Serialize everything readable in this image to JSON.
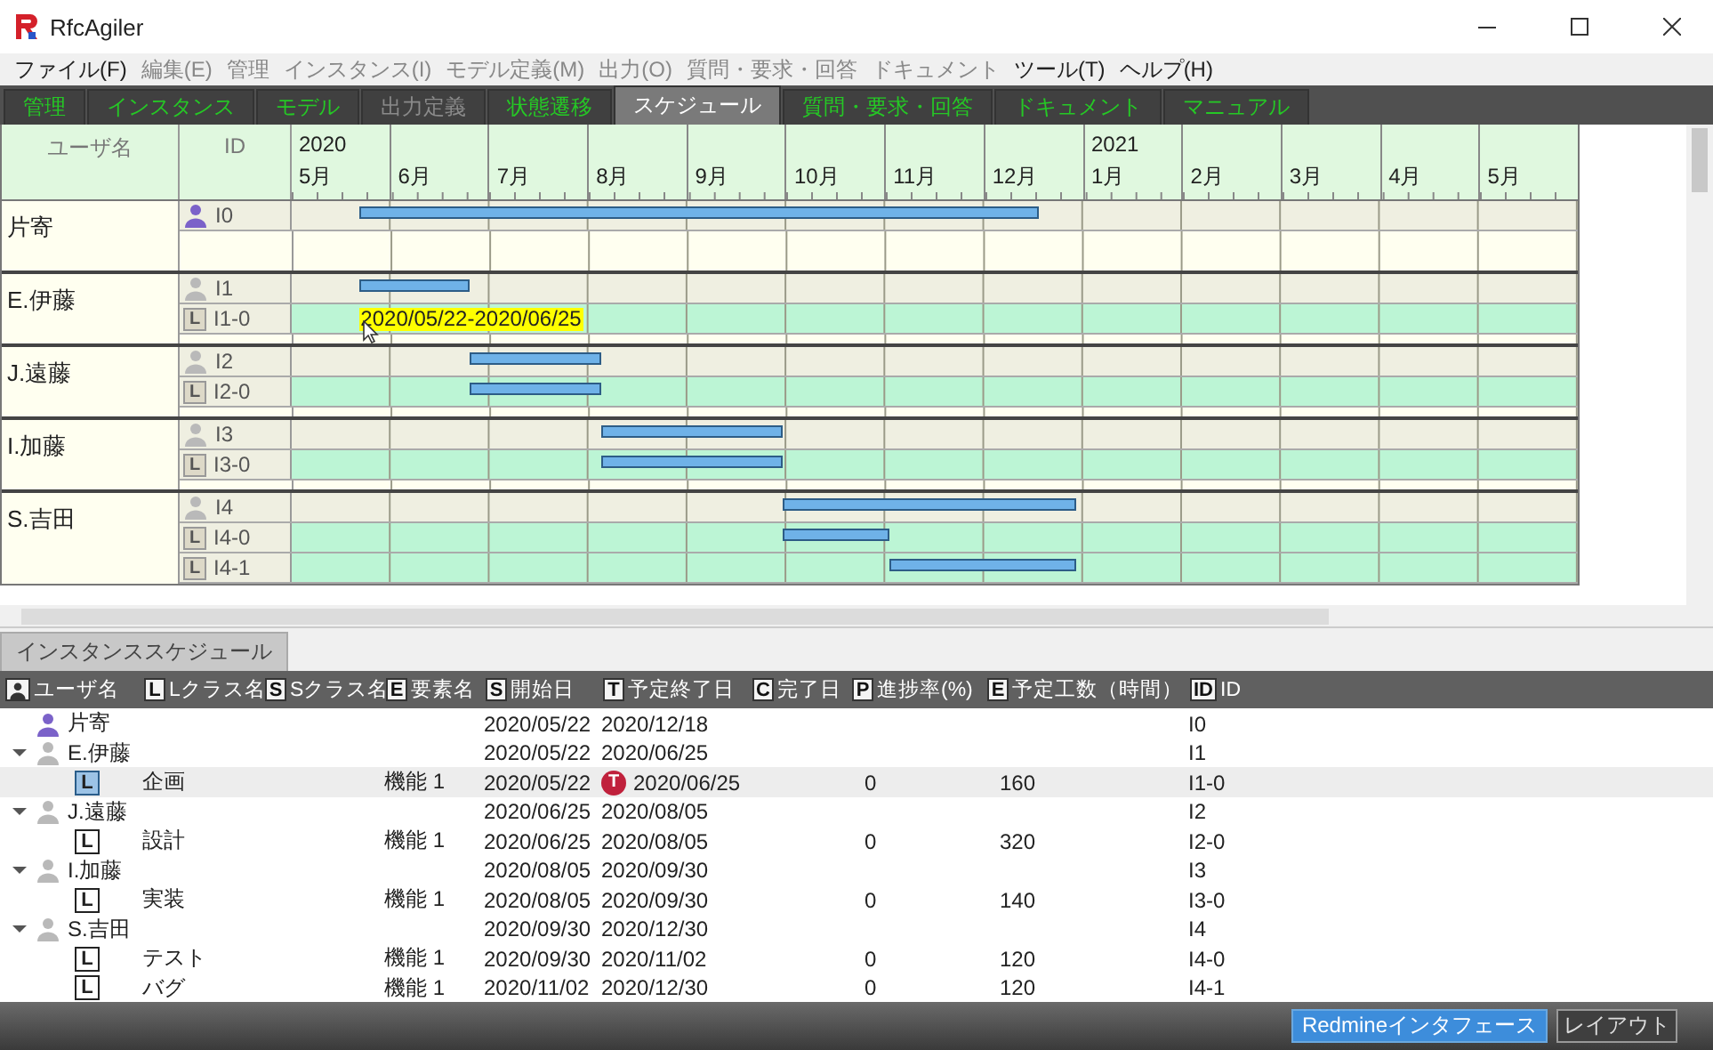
{
  "window": {
    "title": "RfcAgiler"
  },
  "menu": [
    {
      "label": "ファイル(F)",
      "disabled": false
    },
    {
      "label": "編集(E)",
      "disabled": true
    },
    {
      "label": "管理",
      "disabled": true
    },
    {
      "label": "インスタンス(I)",
      "disabled": true
    },
    {
      "label": "モデル定義(M)",
      "disabled": true
    },
    {
      "label": "出力(O)",
      "disabled": true
    },
    {
      "label": "質問・要求・回答",
      "disabled": true
    },
    {
      "label": "ドキュメント",
      "disabled": true
    },
    {
      "label": "ツール(T)",
      "disabled": false
    },
    {
      "label": "ヘルプ(H)",
      "disabled": false
    }
  ],
  "tabs": [
    {
      "label": "管理",
      "selected": false,
      "disabled": false
    },
    {
      "label": "インスタンス",
      "selected": false,
      "disabled": false
    },
    {
      "label": "モデル",
      "selected": false,
      "disabled": false
    },
    {
      "label": "出力定義",
      "selected": false,
      "disabled": true
    },
    {
      "label": "状態遷移",
      "selected": false,
      "disabled": false
    },
    {
      "label": "スケジュール",
      "selected": true,
      "disabled": false
    },
    {
      "label": "質問・要求・回答",
      "selected": false,
      "disabled": false
    },
    {
      "label": "ドキュメント",
      "selected": false,
      "disabled": false
    },
    {
      "label": "マニュアル",
      "selected": false,
      "disabled": false
    }
  ],
  "gantt": {
    "columns": [
      "ユーザ名",
      "ID"
    ],
    "months": [
      {
        "label": "5月",
        "year": "2020"
      },
      {
        "label": "6月"
      },
      {
        "label": "7月"
      },
      {
        "label": "8月"
      },
      {
        "label": "9月"
      },
      {
        "label": "10月"
      },
      {
        "label": "11月"
      },
      {
        "label": "12月"
      },
      {
        "label": "1月",
        "year": "2021"
      },
      {
        "label": "2月"
      },
      {
        "label": "3月"
      },
      {
        "label": "4月"
      },
      {
        "label": "5月"
      }
    ],
    "groups": [
      {
        "user": "片寄",
        "rows": [
          {
            "kind": "person",
            "id": "I0",
            "color": "#7b62c9"
          }
        ]
      },
      {
        "user": "E.伊藤",
        "rows": [
          {
            "kind": "person",
            "id": "I1",
            "color": "#b9b9b9"
          },
          {
            "kind": "class",
            "badge": "L",
            "id": "I1-0",
            "tooltip": "2020/05/22-2020/06/25"
          }
        ]
      },
      {
        "user": "J.遠藤",
        "rows": [
          {
            "kind": "person",
            "id": "I2",
            "color": "#b9b9b9"
          },
          {
            "kind": "class",
            "badge": "L",
            "id": "I2-0"
          }
        ]
      },
      {
        "user": "I.加藤",
        "rows": [
          {
            "kind": "person",
            "id": "I3",
            "color": "#b9b9b9"
          },
          {
            "kind": "class",
            "badge": "L",
            "id": "I3-0"
          }
        ]
      },
      {
        "user": "S.吉田",
        "rows": [
          {
            "kind": "person",
            "id": "I4",
            "color": "#b9b9b9"
          },
          {
            "kind": "class",
            "badge": "L",
            "id": "I4-0"
          },
          {
            "kind": "class",
            "badge": "L",
            "id": "I4-1"
          }
        ]
      }
    ]
  },
  "schedule": {
    "tab": {
      "label": "インスタンススケジュール",
      "selected": true
    },
    "columns": [
      {
        "kind": "person",
        "label": "ユーザ名"
      },
      {
        "kind": "letter",
        "badge": "L",
        "label": "Lクラス名"
      },
      {
        "kind": "letter",
        "badge": "S",
        "label": "Sクラス名"
      },
      {
        "kind": "letter",
        "badge": "E",
        "label": "要素名"
      },
      {
        "kind": "letter",
        "badge": "S",
        "label": "開始日"
      },
      {
        "kind": "letter",
        "badge": "T",
        "label": "予定終了日"
      },
      {
        "kind": "letter",
        "badge": "C",
        "label": "完了日"
      },
      {
        "kind": "letter",
        "badge": "P",
        "label": "進捗率(%)"
      },
      {
        "kind": "letter",
        "badge": "E",
        "label": "予定工数（時間）"
      },
      {
        "kind": "letter",
        "badge": "ID",
        "label": "ID"
      }
    ],
    "rows": [
      {
        "user": "片寄",
        "color": "#7b62c9",
        "start": "2020/05/22",
        "end": "2020/12/18",
        "id": "I0",
        "selected": false,
        "children": []
      },
      {
        "user": "E.伊藤",
        "color": "#b9b9b9",
        "start": "2020/05/22",
        "end": "2020/06/25",
        "id": "I1",
        "selected": false,
        "expanded": true,
        "children": [
          {
            "badge": "L",
            "class_name": "企画",
            "element": "機能 1",
            "start": "2020/05/22",
            "end": "2020/06/25",
            "end_marker": "T",
            "progress": "0",
            "effort": "160",
            "id": "I1-0",
            "selected": true
          }
        ]
      },
      {
        "user": "J.遠藤",
        "color": "#b9b9b9",
        "start": "2020/06/25",
        "end": "2020/08/05",
        "id": "I2",
        "selected": false,
        "expanded": true,
        "children": [
          {
            "badge": "L",
            "class_name": "設計",
            "element": "機能 1",
            "start": "2020/06/25",
            "end": "2020/08/05",
            "progress": "0",
            "effort": "320",
            "id": "I2-0",
            "selected": false
          }
        ]
      },
      {
        "user": "I.加藤",
        "color": "#b9b9b9",
        "start": "2020/08/05",
        "end": "2020/09/30",
        "id": "I3",
        "selected": false,
        "expanded": true,
        "children": [
          {
            "badge": "L",
            "class_name": "実装",
            "element": "機能 1",
            "start": "2020/08/05",
            "end": "2020/09/30",
            "progress": "0",
            "effort": "140",
            "id": "I3-0",
            "selected": false
          }
        ]
      },
      {
        "user": "S.吉田",
        "color": "#b9b9b9",
        "start": "2020/09/30",
        "end": "2020/12/30",
        "id": "I4",
        "selected": false,
        "expanded": true,
        "children": [
          {
            "badge": "L",
            "class_name": "テスト",
            "element": "機能 1",
            "start": "2020/09/30",
            "end": "2020/11/02",
            "progress": "0",
            "effort": "120",
            "id": "I4-0",
            "selected": false
          },
          {
            "badge": "L",
            "class_name": "バグ",
            "element": "機能 1",
            "start": "2020/11/02",
            "end": "2020/12/30",
            "progress": "0",
            "effort": "120",
            "id": "I4-1",
            "selected": false
          }
        ]
      }
    ]
  },
  "status_bar": {
    "buttons": [
      {
        "label": "Redmineインタフェース",
        "kind": "primary"
      },
      {
        "label": "レイアウト",
        "kind": "secondary"
      }
    ]
  }
}
